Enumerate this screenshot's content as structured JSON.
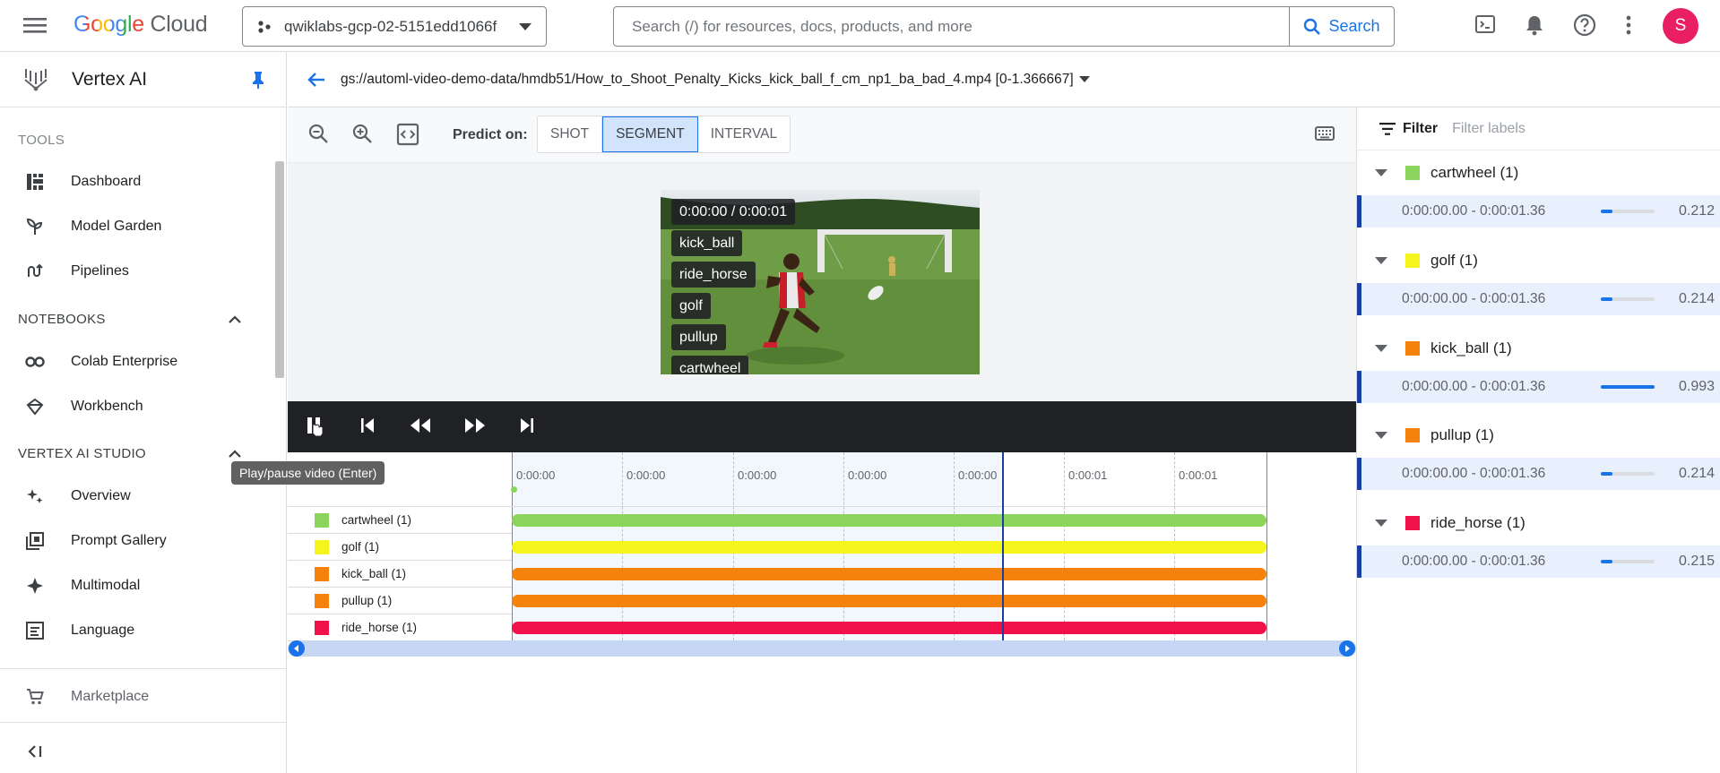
{
  "topbar": {
    "logo_google": "Google",
    "logo_cloud": "Cloud",
    "project": "qwiklabs-gcp-02-5151edd1066f",
    "search_placeholder": "Search (/) for resources, docs, products, and more",
    "search_button": "Search",
    "avatar_letter": "S"
  },
  "sidebar": {
    "title": "Vertex AI",
    "tools_label": "TOOLS",
    "tools": [
      {
        "label": "Dashboard",
        "icon": "dashboard-icon"
      },
      {
        "label": "Model Garden",
        "icon": "model-garden-icon"
      },
      {
        "label": "Pipelines",
        "icon": "pipelines-icon"
      }
    ],
    "notebooks_label": "NOTEBOOKS",
    "notebooks": [
      {
        "label": "Colab Enterprise",
        "icon": "colab-icon"
      },
      {
        "label": "Workbench",
        "icon": "workbench-icon"
      }
    ],
    "studio_label": "VERTEX AI STUDIO",
    "studio": [
      {
        "label": "Overview",
        "icon": "sparkle-icon"
      },
      {
        "label": "Prompt Gallery",
        "icon": "gallery-icon"
      },
      {
        "label": "Multimodal",
        "icon": "multimodal-icon"
      },
      {
        "label": "Language",
        "icon": "language-icon"
      }
    ],
    "marketplace": "Marketplace",
    "tooltip": "Play/pause video (Enter)"
  },
  "main": {
    "path": "gs://automl-video-demo-data/hmdb51/How_to_Shoot_Penalty_Kicks_kick_ball_f_cm_np1_ba_bad_4.mp4 [0-1.366667]",
    "predict_on_label": "Predict on:",
    "predict_options": [
      "SHOT",
      "SEGMENT",
      "INTERVAL"
    ],
    "predict_selected": "SEGMENT",
    "video_time": "0:00:00 / 0:00:01",
    "video_labels": [
      "kick_ball",
      "ride_horse",
      "golf",
      "pullup",
      "cartwheel"
    ]
  },
  "timeline": {
    "ticks": [
      "0:00:00",
      "0:00:00",
      "0:00:00",
      "0:00:00",
      "0:00:00",
      "0:00:01",
      "0:00:01"
    ],
    "playhead_fraction": 0.65,
    "tracks": [
      {
        "label": "cartwheel (1)",
        "color": "#8bd55c"
      },
      {
        "label": "golf (1)",
        "color": "#f5f51c"
      },
      {
        "label": "kick_ball (1)",
        "color": "#f5820d"
      },
      {
        "label": "pullup (1)",
        "color": "#f5820d"
      },
      {
        "label": "ride_horse (1)",
        "color": "#f0104a"
      }
    ]
  },
  "panel": {
    "filter_label": "Filter",
    "filter_placeholder": "Filter labels",
    "groups": [
      {
        "name": "cartwheel (1)",
        "color": "#8bd55c",
        "time": "0:00:00.00 - 0:00:01.36",
        "score": "0.212",
        "fraction": 0.212
      },
      {
        "name": "golf (1)",
        "color": "#f5f51c",
        "time": "0:00:00.00 - 0:00:01.36",
        "score": "0.214",
        "fraction": 0.214
      },
      {
        "name": "kick_ball (1)",
        "color": "#f5820d",
        "time": "0:00:00.00 - 0:00:01.36",
        "score": "0.993",
        "fraction": 0.993
      },
      {
        "name": "pullup (1)",
        "color": "#f5820d",
        "time": "0:00:00.00 - 0:00:01.36",
        "score": "0.214",
        "fraction": 0.214
      },
      {
        "name": "ride_horse (1)",
        "color": "#f0104a",
        "time": "0:00:00.00 - 0:00:01.36",
        "score": "0.215",
        "fraction": 0.215
      }
    ]
  }
}
